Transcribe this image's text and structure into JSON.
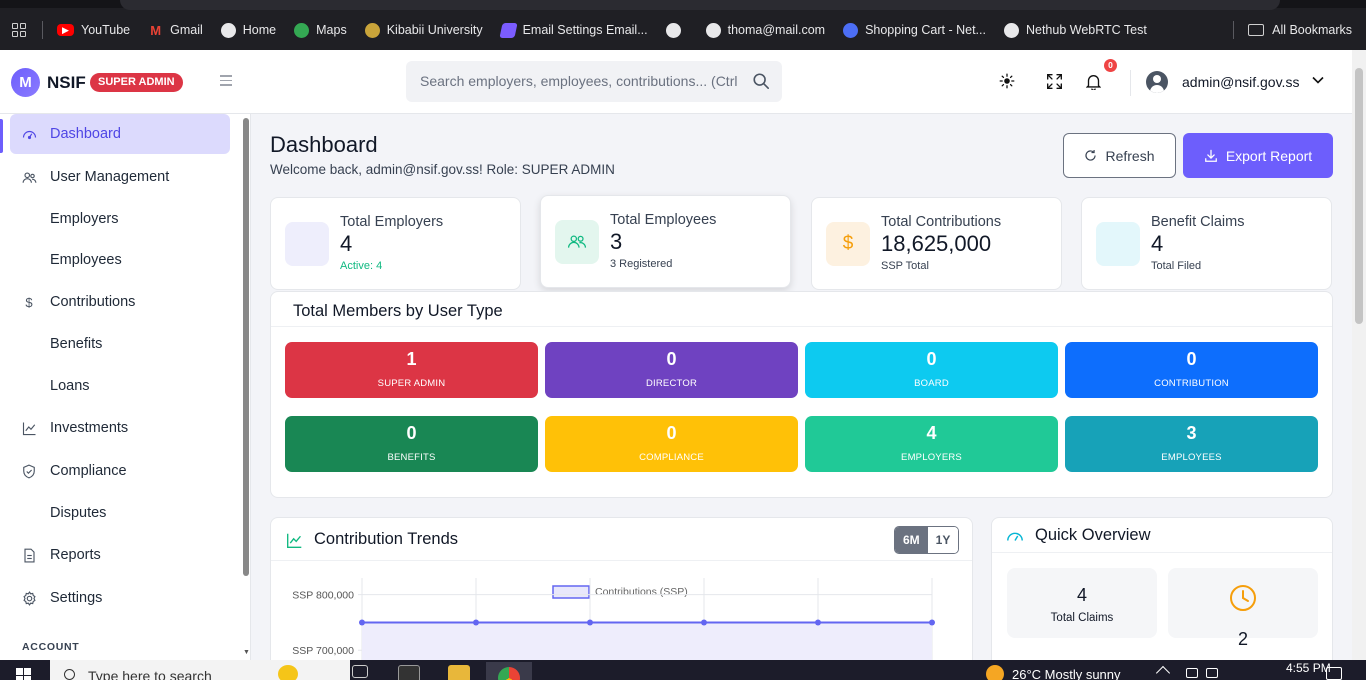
{
  "bookmarks": {
    "items": [
      {
        "label": "YouTube",
        "icon": "youtube-icon"
      },
      {
        "label": "Gmail",
        "icon": "gmail-icon"
      },
      {
        "label": "Home",
        "icon": "globe-icon"
      },
      {
        "label": "Maps",
        "icon": "maps-icon"
      },
      {
        "label": "Kibabii University",
        "icon": "university-icon"
      },
      {
        "label": "Email Settings Email...",
        "icon": "email-icon"
      },
      {
        "label": "",
        "icon": "globe-icon"
      },
      {
        "label": "thoma@mail.com",
        "icon": "globe-icon"
      },
      {
        "label": "Shopping Cart - Net...",
        "icon": "shop-icon"
      },
      {
        "label": "Nethub WebRTC Test",
        "icon": "globe-icon"
      }
    ],
    "all_bookmarks": "All Bookmarks"
  },
  "header": {
    "logo_letter": "M",
    "brand": "NSIF",
    "role_badge": "SUPER ADMIN",
    "search_placeholder": "Search employers, employees, contributions... (Ctrl",
    "notification_count": "0",
    "user_email": "admin@nsif.gov.ss"
  },
  "sidebar": {
    "items": [
      {
        "label": "Dashboard",
        "icon": "dashboard-icon",
        "active": true
      },
      {
        "label": "User Management",
        "icon": "users-icon"
      },
      {
        "label": "Employers",
        "icon": ""
      },
      {
        "label": "Employees",
        "icon": ""
      },
      {
        "label": "Contributions",
        "icon": "dollar-icon"
      },
      {
        "label": "Benefits",
        "icon": ""
      },
      {
        "label": "Loans",
        "icon": ""
      },
      {
        "label": "Investments",
        "icon": "chart-line-icon"
      },
      {
        "label": "Compliance",
        "icon": "shield-icon"
      },
      {
        "label": "Disputes",
        "icon": ""
      },
      {
        "label": "Reports",
        "icon": "report-icon"
      },
      {
        "label": "Settings",
        "icon": "gear-icon"
      }
    ],
    "section_account": "ACCOUNT"
  },
  "main": {
    "title": "Dashboard",
    "subtitle": "Welcome back, admin@nsif.gov.ss! Role: SUPER ADMIN",
    "refresh_label": "Refresh",
    "export_label": "Export Report",
    "stats": [
      {
        "label": "Total Employers",
        "value": "4",
        "foot": "Active: 4",
        "color": "#6d5efc"
      },
      {
        "label": "Total Employees",
        "value": "3",
        "foot": "3 Registered",
        "color": "#10b981"
      },
      {
        "label": "Total Contributions",
        "value": "18,625,000",
        "foot": "SSP Total",
        "color": "#f59e0b"
      },
      {
        "label": "Benefit Claims",
        "value": "4",
        "foot": "Total Filed",
        "color": "#06b6d4"
      }
    ],
    "members": {
      "title": "Total Members by User Type",
      "tiles": [
        {
          "value": "1",
          "label": "SUPER ADMIN",
          "color": "#dc3545"
        },
        {
          "value": "0",
          "label": "DIRECTOR",
          "color": "#6f42c1"
        },
        {
          "value": "0",
          "label": "BOARD",
          "color": "#0dcaf0"
        },
        {
          "value": "0",
          "label": "CONTRIBUTION",
          "color": "#0d6efd"
        },
        {
          "value": "0",
          "label": "BENEFITS",
          "color": "#198754"
        },
        {
          "value": "0",
          "label": "COMPLIANCE",
          "color": "#ffc107"
        },
        {
          "value": "4",
          "label": "EMPLOYERS",
          "color": "#20c997"
        },
        {
          "value": "3",
          "label": "EMPLOYEES",
          "color": "#17a2b8"
        }
      ]
    },
    "trends": {
      "title": "Contribution Trends",
      "range_6m": "6M",
      "range_1y": "1Y"
    },
    "quick_overview": {
      "title": "Quick Overview",
      "total_claims_value": "4",
      "total_claims_label": "Total Claims",
      "pending_value": "2"
    }
  },
  "chart_data": {
    "type": "line",
    "series": [
      {
        "name": "Contributions (SSP)",
        "values": [
          750000,
          750000,
          750000,
          750000,
          750000,
          750000
        ]
      }
    ],
    "ytick_labels": [
      "SSP 800,000",
      "SSP 700,000"
    ],
    "ylim": [
      650000,
      830000
    ],
    "grid": true,
    "legend": "top-center",
    "color": "#6366f1"
  },
  "taskbar": {
    "search_text": "Type here to search",
    "weather": "26°C  Mostly sunny",
    "time": "4:55 PM"
  }
}
